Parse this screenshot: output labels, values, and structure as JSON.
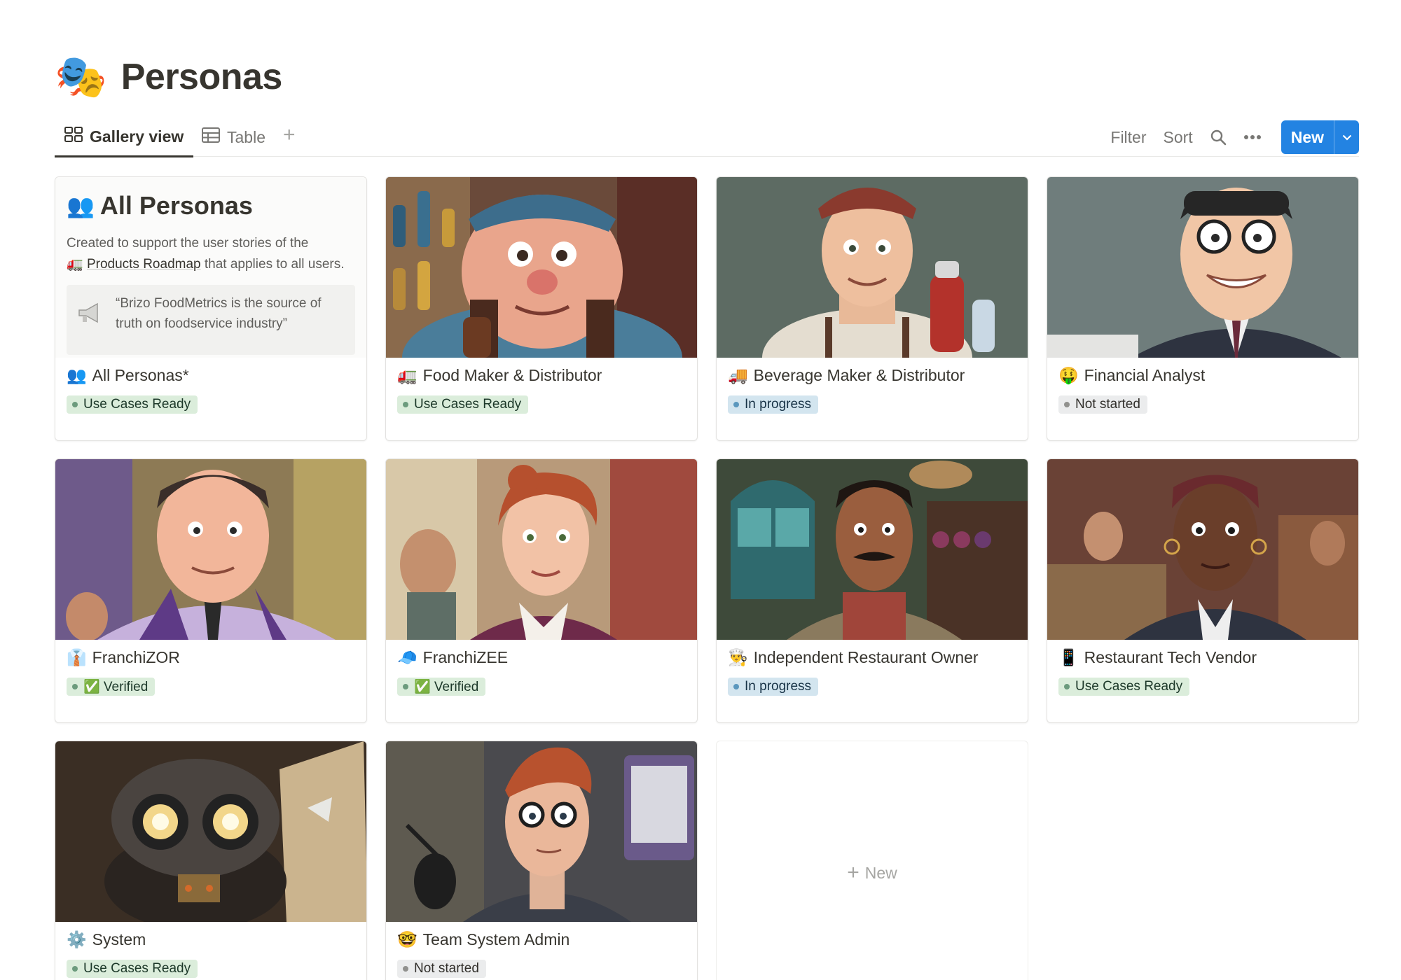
{
  "page": {
    "icon": "🎭",
    "title": "Personas"
  },
  "views": [
    {
      "label": "Gallery view",
      "icon": "gallery-icon",
      "active": true
    },
    {
      "label": "Table",
      "icon": "table-icon",
      "active": false
    }
  ],
  "toolbar": {
    "filter": "Filter",
    "sort": "Sort",
    "new_label": "New"
  },
  "all_personas": {
    "icon": "👥",
    "heading": "All Personas",
    "description_before": "Created to support the user stories of the",
    "link_icon": "🚛",
    "link_text": "Products Roadmap",
    "description_after": "that applies to all users.",
    "quote": "“Brizo FoodMetrics is the source of truth on foodservice industry”"
  },
  "cards": [
    {
      "emoji": "👥",
      "title": "All Personas*",
      "status": "Use Cases Ready",
      "color": "green"
    },
    {
      "emoji": "🚛",
      "title": "Food Maker & Distributor",
      "status": "Use Cases Ready",
      "color": "green"
    },
    {
      "emoji": "🚚",
      "title": "Beverage Maker & Distributor",
      "status": "In progress",
      "color": "blue"
    },
    {
      "emoji": "🤑",
      "title": "Financial Analyst",
      "status": "Not started",
      "color": "gray"
    },
    {
      "emoji": "👔",
      "title": "FranchiZOR",
      "status": "✅ Verified",
      "color": "green"
    },
    {
      "emoji": "🧢",
      "title": "FranchiZEE",
      "status": "✅ Verified",
      "color": "green"
    },
    {
      "emoji": "👨‍🍳",
      "title": "Independent Restaurant Owner",
      "status": "In progress",
      "color": "blue"
    },
    {
      "emoji": "📱",
      "title": "Restaurant Tech Vendor",
      "status": "Use Cases Ready",
      "color": "green"
    },
    {
      "emoji": "⚙️",
      "title": "System",
      "status": "Use Cases Ready",
      "color": "green"
    },
    {
      "emoji": "🤓",
      "title": "Team System Admin",
      "status": "Not started",
      "color": "gray"
    }
  ],
  "new_card_label": "New"
}
